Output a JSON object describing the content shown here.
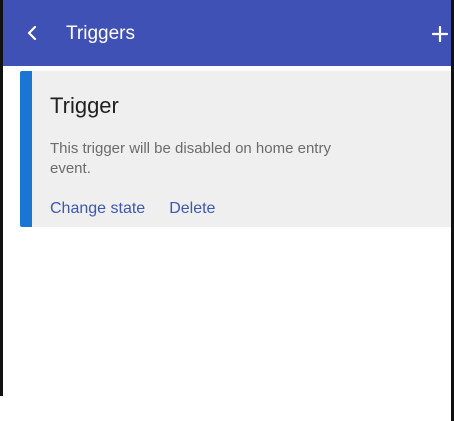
{
  "appbar": {
    "back_icon": "chevron-left-icon",
    "title": "Triggers",
    "add_icon": "plus-icon",
    "background_color": "#3f51b5"
  },
  "trigger_card": {
    "title": "Trigger",
    "description": "This trigger will be disabled on home entry event.",
    "accent_color": "#1a76d2",
    "actions": [
      {
        "label": "Change state"
      },
      {
        "label": "Delete"
      }
    ]
  }
}
